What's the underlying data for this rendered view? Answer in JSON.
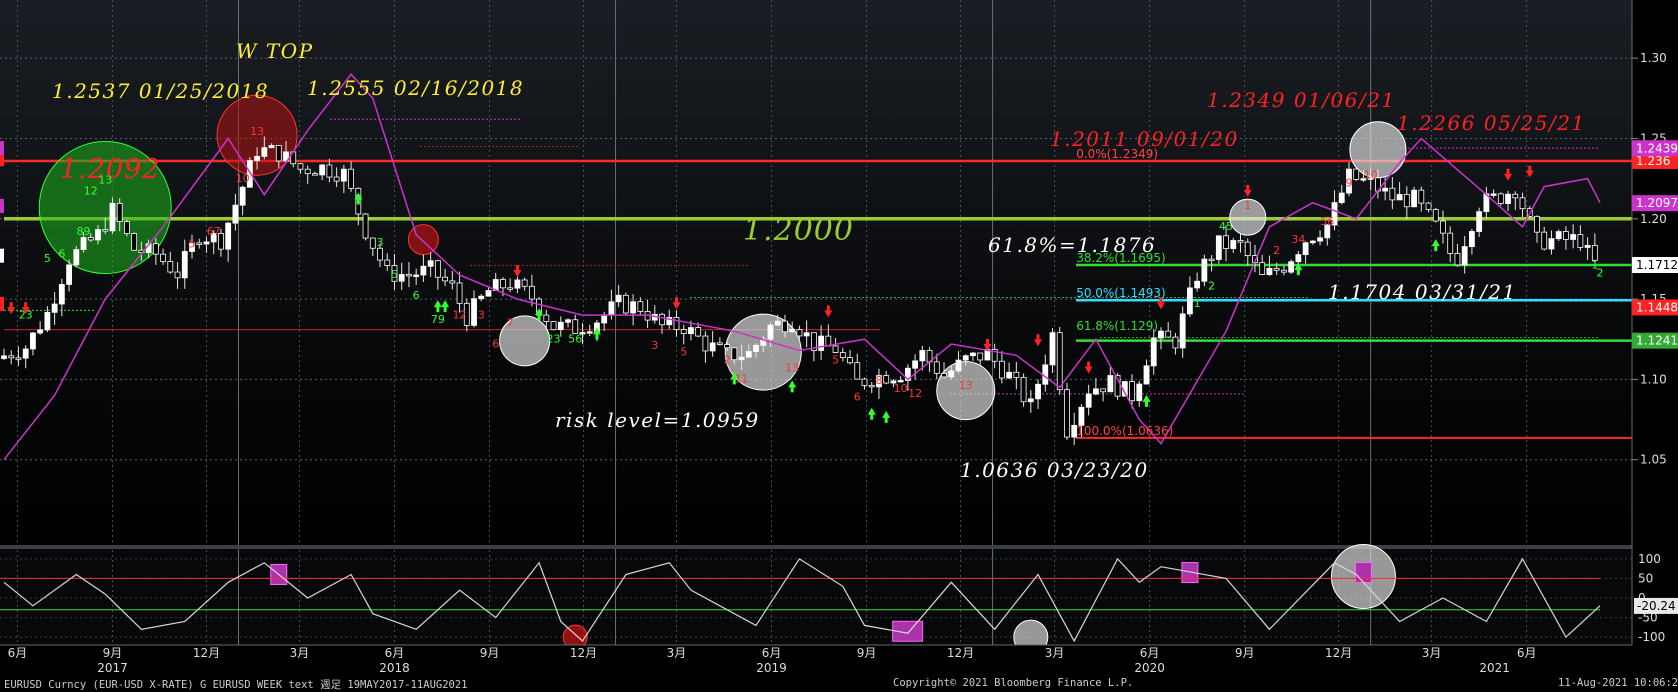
{
  "footer": {
    "left": "EURUSD Curncy (EUR-USD X-RATE) G EURUSD WEEK text  週足 19MAY2017-11AUG2021",
    "center": "Copyright© 2021 Bloomberg Finance L.P.",
    "right": "11-Aug-2021 10:06:23"
  },
  "colors": {
    "background": "#000000",
    "up_candle": "#ffffff",
    "down_candle": "#ffffff",
    "line_1_2000": "#9ACD32",
    "red_line": "#ff2a2a",
    "cyan_line": "#33ddff",
    "green_line": "#33dd33",
    "magenta": "#cc33cc",
    "annotation_yellow": "#ffee33",
    "annotation_red": "#ff2222",
    "annotation_white": "#ffffff"
  },
  "chart_data": [
    {
      "type": "line",
      "title": "",
      "panel": "price",
      "y_axis": {
        "ticks": [
          "1.05",
          "1.10",
          "1.15",
          "1.20",
          "1.25",
          "1.30"
        ],
        "ylim": [
          1.0,
          1.325
        ]
      },
      "x_axis": {
        "month_ticks": [
          "6月",
          "9月",
          "12月",
          "3月",
          "6月",
          "9月",
          "12月",
          "3月",
          "6月",
          "9月",
          "12月",
          "3月",
          "6月",
          "9月",
          "12月",
          "3月",
          "6月"
        ],
        "year_ticks": [
          "2017",
          "2018",
          "2019",
          "2020",
          "2021"
        ],
        "xlim": [
          "2017-05-19",
          "2021-08-11"
        ]
      },
      "series": [
        {
          "style": "weekly-candles",
          "points": [
            [
              "2017-05-19",
              1.113
            ],
            [
              "2017-06-16",
              1.12
            ],
            [
              "2017-07-07",
              1.141
            ],
            [
              "2017-07-28",
              1.175
            ],
            [
              "2017-08-25",
              1.19
            ],
            [
              "2017-09-08",
              1.205
            ],
            [
              "2017-09-29",
              1.181
            ],
            [
              "2017-10-20",
              1.178
            ],
            [
              "2017-11-10",
              1.166
            ],
            [
              "2017-12-01",
              1.19
            ],
            [
              "2017-12-22",
              1.187
            ],
            [
              "2018-01-12",
              1.22
            ],
            [
              "2018-01-26",
              1.243
            ],
            [
              "2018-02-16",
              1.241
            ],
            [
              "2018-03-09",
              1.231
            ],
            [
              "2018-03-30",
              1.232
            ],
            [
              "2018-04-20",
              1.228
            ],
            [
              "2018-05-11",
              1.193
            ],
            [
              "2018-06-01",
              1.166
            ],
            [
              "2018-06-22",
              1.165
            ],
            [
              "2018-07-13",
              1.168
            ],
            [
              "2018-08-03",
              1.157
            ],
            [
              "2018-08-17",
              1.139
            ],
            [
              "2018-09-07",
              1.155
            ],
            [
              "2018-09-28",
              1.16
            ],
            [
              "2018-10-19",
              1.151
            ],
            [
              "2018-11-09",
              1.133
            ],
            [
              "2018-11-30",
              1.132
            ],
            [
              "2018-12-21",
              1.137
            ],
            [
              "2019-01-11",
              1.147
            ],
            [
              "2019-02-01",
              1.145
            ],
            [
              "2019-02-22",
              1.133
            ],
            [
              "2019-03-15",
              1.133
            ],
            [
              "2019-04-05",
              1.122
            ],
            [
              "2019-04-26",
              1.115
            ],
            [
              "2019-05-17",
              1.116
            ],
            [
              "2019-06-07",
              1.133
            ],
            [
              "2019-06-28",
              1.137
            ],
            [
              "2019-07-19",
              1.122
            ],
            [
              "2019-08-09",
              1.119
            ],
            [
              "2019-08-30",
              1.098
            ],
            [
              "2019-09-20",
              1.102
            ],
            [
              "2019-10-11",
              1.104
            ],
            [
              "2019-11-01",
              1.116
            ],
            [
              "2019-11-22",
              1.102
            ],
            [
              "2019-12-13",
              1.112
            ],
            [
              "2020-01-03",
              1.116
            ],
            [
              "2020-01-24",
              1.102
            ],
            [
              "2020-02-14",
              1.083
            ],
            [
              "2020-03-06",
              1.128
            ],
            [
              "2020-03-20",
              1.069
            ],
            [
              "2020-04-10",
              1.094
            ],
            [
              "2020-05-01",
              1.098
            ],
            [
              "2020-05-22",
              1.09
            ],
            [
              "2020-06-12",
              1.125
            ],
            [
              "2020-07-03",
              1.124
            ],
            [
              "2020-07-24",
              1.165
            ],
            [
              "2020-08-14",
              1.184
            ],
            [
              "2020-09-04",
              1.183
            ],
            [
              "2020-09-25",
              1.163
            ],
            [
              "2020-10-16",
              1.171
            ],
            [
              "2020-11-06",
              1.187
            ],
            [
              "2020-11-27",
              1.196
            ],
            [
              "2020-12-18",
              1.226
            ],
            [
              "2021-01-08",
              1.222
            ],
            [
              "2021-01-29",
              1.213
            ],
            [
              "2021-02-19",
              1.212
            ],
            [
              "2021-03-12",
              1.195
            ],
            [
              "2021-03-31",
              1.173
            ],
            [
              "2021-04-23",
              1.209
            ],
            [
              "2021-05-14",
              1.214
            ],
            [
              "2021-05-28",
              1.219
            ],
            [
              "2021-06-18",
              1.186
            ],
            [
              "2021-07-09",
              1.187
            ],
            [
              "2021-07-30",
              1.187
            ],
            [
              "2021-08-11",
              1.172
            ]
          ]
        },
        {
          "style": "magenta-line",
          "points": [
            [
              "2017-05-19",
              1.05
            ],
            [
              "2017-07-07",
              1.09
            ],
            [
              "2017-08-25",
              1.15
            ],
            [
              "2017-10-20",
              1.195
            ],
            [
              "2017-12-22",
              1.25
            ],
            [
              "2018-01-26",
              1.215
            ],
            [
              "2018-03-09",
              1.255
            ],
            [
              "2018-04-20",
              1.29
            ],
            [
              "2018-05-11",
              1.275
            ],
            [
              "2018-06-22",
              1.19
            ],
            [
              "2018-08-03",
              1.165
            ],
            [
              "2018-09-28",
              1.15
            ],
            [
              "2018-11-30",
              1.14
            ],
            [
              "2019-02-01",
              1.14
            ],
            [
              "2019-04-26",
              1.13
            ],
            [
              "2019-06-28",
              1.118
            ],
            [
              "2019-08-30",
              1.125
            ],
            [
              "2019-10-11",
              1.1
            ],
            [
              "2019-11-22",
              1.122
            ],
            [
              "2020-01-24",
              1.115
            ],
            [
              "2020-03-06",
              1.095
            ],
            [
              "2020-04-10",
              1.125
            ],
            [
              "2020-05-22",
              1.075
            ],
            [
              "2020-06-12",
              1.06
            ],
            [
              "2020-08-14",
              1.13
            ],
            [
              "2020-09-25",
              1.195
            ],
            [
              "2020-11-06",
              1.21
            ],
            [
              "2020-12-18",
              1.2
            ],
            [
              "2021-01-29",
              1.235
            ],
            [
              "2021-02-19",
              1.25
            ],
            [
              "2021-04-23",
              1.215
            ],
            [
              "2021-05-28",
              1.195
            ],
            [
              "2021-06-18",
              1.22
            ],
            [
              "2021-07-30",
              1.225
            ],
            [
              "2021-08-11",
              1.21
            ]
          ]
        },
        {
          "style": "oscillator",
          "panel": "lower",
          "y_axis": {
            "ticks": [
              "100",
              "50",
              "0",
              "-50",
              "-100"
            ],
            "ylim": [
              -115,
              115
            ]
          },
          "last_value": "-20.24",
          "points": [
            [
              "2017-05-19",
              40
            ],
            [
              "2017-06-16",
              -20
            ],
            [
              "2017-07-28",
              60
            ],
            [
              "2017-08-25",
              10
            ],
            [
              "2017-09-29",
              -80
            ],
            [
              "2017-11-10",
              -60
            ],
            [
              "2017-12-22",
              40
            ],
            [
              "2018-01-26",
              90
            ],
            [
              "2018-03-09",
              0
            ],
            [
              "2018-04-20",
              60
            ],
            [
              "2018-05-11",
              -40
            ],
            [
              "2018-06-22",
              -80
            ],
            [
              "2018-08-03",
              20
            ],
            [
              "2018-09-07",
              -50
            ],
            [
              "2018-10-19",
              90
            ],
            [
              "2018-11-09",
              -60
            ],
            [
              "2018-11-30",
              -110
            ],
            [
              "2019-01-11",
              60
            ],
            [
              "2019-02-22",
              90
            ],
            [
              "2019-03-15",
              20
            ],
            [
              "2019-05-17",
              -70
            ],
            [
              "2019-06-28",
              100
            ],
            [
              "2019-08-09",
              30
            ],
            [
              "2019-08-30",
              -70
            ],
            [
              "2019-10-11",
              -90
            ],
            [
              "2019-11-22",
              40
            ],
            [
              "2020-01-03",
              -80
            ],
            [
              "2020-02-14",
              60
            ],
            [
              "2020-03-20",
              -110
            ],
            [
              "2020-05-01",
              100
            ],
            [
              "2020-05-22",
              40
            ],
            [
              "2020-06-12",
              80
            ],
            [
              "2020-08-14",
              50
            ],
            [
              "2020-09-25",
              -80
            ],
            [
              "2020-11-27",
              90
            ],
            [
              "2020-12-18",
              60
            ],
            [
              "2021-01-29",
              -60
            ],
            [
              "2021-03-12",
              0
            ],
            [
              "2021-04-23",
              -60
            ],
            [
              "2021-05-28",
              100
            ],
            [
              "2021-07-09",
              -100
            ],
            [
              "2021-08-11",
              -20
            ]
          ]
        }
      ]
    }
  ],
  "price_panel": {
    "right_labels": [
      {
        "text": "1.236",
        "value": 1.236,
        "bg": "#ff2222"
      },
      {
        "text": "1.2439",
        "value": 1.2439,
        "bg": "#cc33cc"
      },
      {
        "text": "1.2097",
        "value": 1.2097,
        "bg": "#cc33cc"
      },
      {
        "text": "1.1712",
        "value": 1.1712,
        "bg": "#ffffff",
        "fg": "#000000"
      },
      {
        "text": "1.1448",
        "value": 1.1448,
        "bg": "#ff2222"
      },
      {
        "text": "1.1241",
        "value": 1.1241,
        "bg": "#33aa33"
      }
    ],
    "h_lines": [
      {
        "value": 1.2,
        "color": "#9ACD32",
        "width": 3.5
      },
      {
        "value": 1.236,
        "color": "#ff2a2a",
        "width": 2.5
      },
      {
        "value": 1.1712,
        "color": "#33dd33",
        "width": 2.5
      },
      {
        "value": 1.1493,
        "color": "#33ddff",
        "width": 2.5
      },
      {
        "value": 1.1241,
        "color": "#33dd33",
        "width": 2.5
      },
      {
        "value": 1.0636,
        "color": "#ff2a2a",
        "width": 2
      },
      {
        "value": 1.131,
        "color": "#cc2222",
        "width": 1
      }
    ],
    "fib_levels": [
      {
        "text": "0.0%(1.2349)",
        "color": "#ff4444",
        "value": 1.236
      },
      {
        "text": "38.2%(1.1695)",
        "color": "#33dd33",
        "value": 1.1712
      },
      {
        "text": "50.0%(1.1493)",
        "color": "#33ddff",
        "value": 1.1493
      },
      {
        "text": "61.8%(1.129)",
        "color": "#33dd33",
        "value": 1.129
      },
      {
        "text": "100.0%(1.0636)",
        "color": "#ff4444",
        "value": 1.0636
      }
    ],
    "annotations": [
      {
        "text": "W TOP",
        "color": "#ffee33"
      },
      {
        "text": "1.2537 01/25/2018",
        "color": "#ffee33"
      },
      {
        "text": "1.2555 02/16/2018",
        "color": "#ffee33"
      },
      {
        "text": "1.2092",
        "color": "#ff2222"
      },
      {
        "text": "1.2000",
        "color": "#9ACD32"
      },
      {
        "text": "61.8%=1.1876",
        "color": "#ffffff"
      },
      {
        "text": "risk level=1.0959",
        "color": "#ffffff"
      },
      {
        "text": "1.0636 03/23/20",
        "color": "#ffffff"
      },
      {
        "text": "1.2011 09/01/20",
        "color": "#ff2222"
      },
      {
        "text": "1.2349 01/06/21",
        "color": "#ff2222"
      },
      {
        "text": "1.2266 05/25/21",
        "color": "#ff2222"
      },
      {
        "text": "1.1704 03/31/21",
        "color": "#ffffff"
      }
    ]
  }
}
